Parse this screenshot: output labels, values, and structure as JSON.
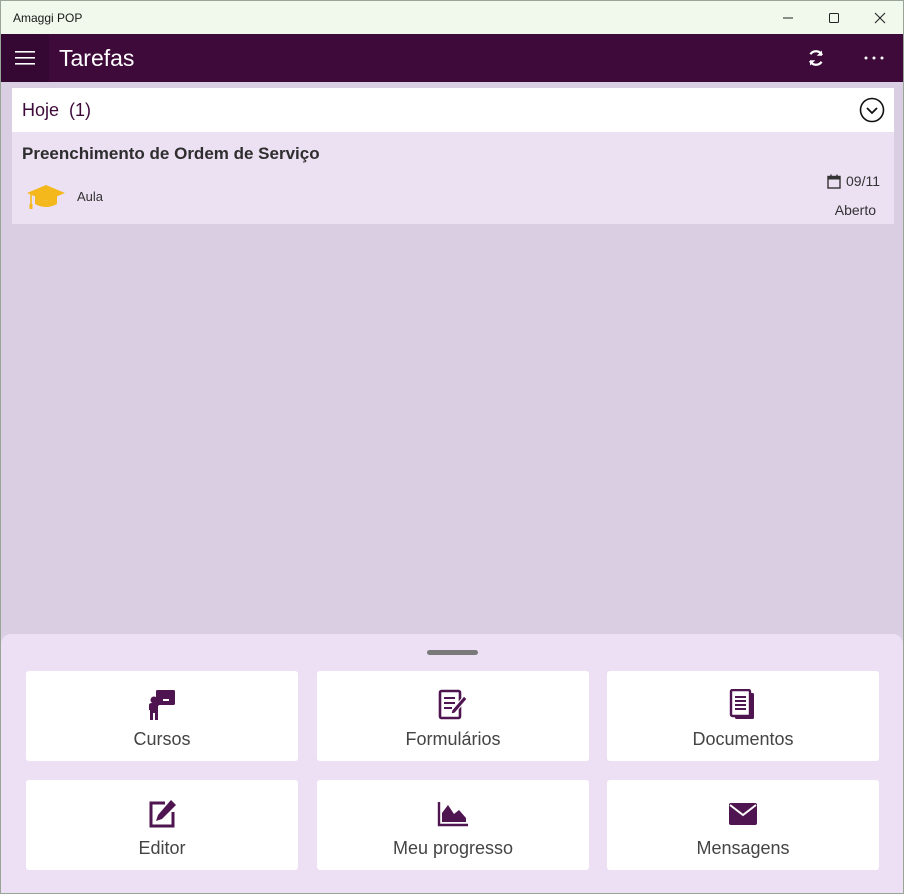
{
  "window": {
    "title": "Amaggi POP",
    "minimize_icon": "minimize-icon",
    "maximize_icon": "maximize-icon",
    "close_icon": "close-icon"
  },
  "appbar": {
    "title": "Tarefas",
    "menu_icon": "hamburger-menu-icon",
    "refresh_icon": "refresh-icon",
    "more_icon": "more-options-icon",
    "background_color": "#3e0a3a"
  },
  "task_group": {
    "label": "Hoje",
    "count": "(1)",
    "toggle_icon": "chevron-down-circle-icon",
    "tasks": [
      {
        "title": "Preenchimento de Ordem de Serviço",
        "type": "Aula",
        "type_icon": "graduation-cap-icon",
        "date": "09/11",
        "date_icon": "calendar-icon",
        "status": "Aberto"
      }
    ]
  },
  "bottom_menu": {
    "handle": "drag-handle",
    "tiles": [
      {
        "label": "Cursos",
        "icon": "teacher-board-icon"
      },
      {
        "label": "Formulários",
        "icon": "form-edit-icon"
      },
      {
        "label": "Documentos",
        "icon": "documents-icon"
      },
      {
        "label": "Editor",
        "icon": "edit-icon"
      },
      {
        "label": "Meu progresso",
        "icon": "area-chart-icon"
      },
      {
        "label": "Mensagens",
        "icon": "envelope-icon"
      }
    ]
  },
  "colors": {
    "accent": "#3e0a3a",
    "background": "#dacfe2",
    "card": "#ece0f3",
    "titlebar": "#f0f9ec",
    "icon_gold": "#f5b81c"
  }
}
